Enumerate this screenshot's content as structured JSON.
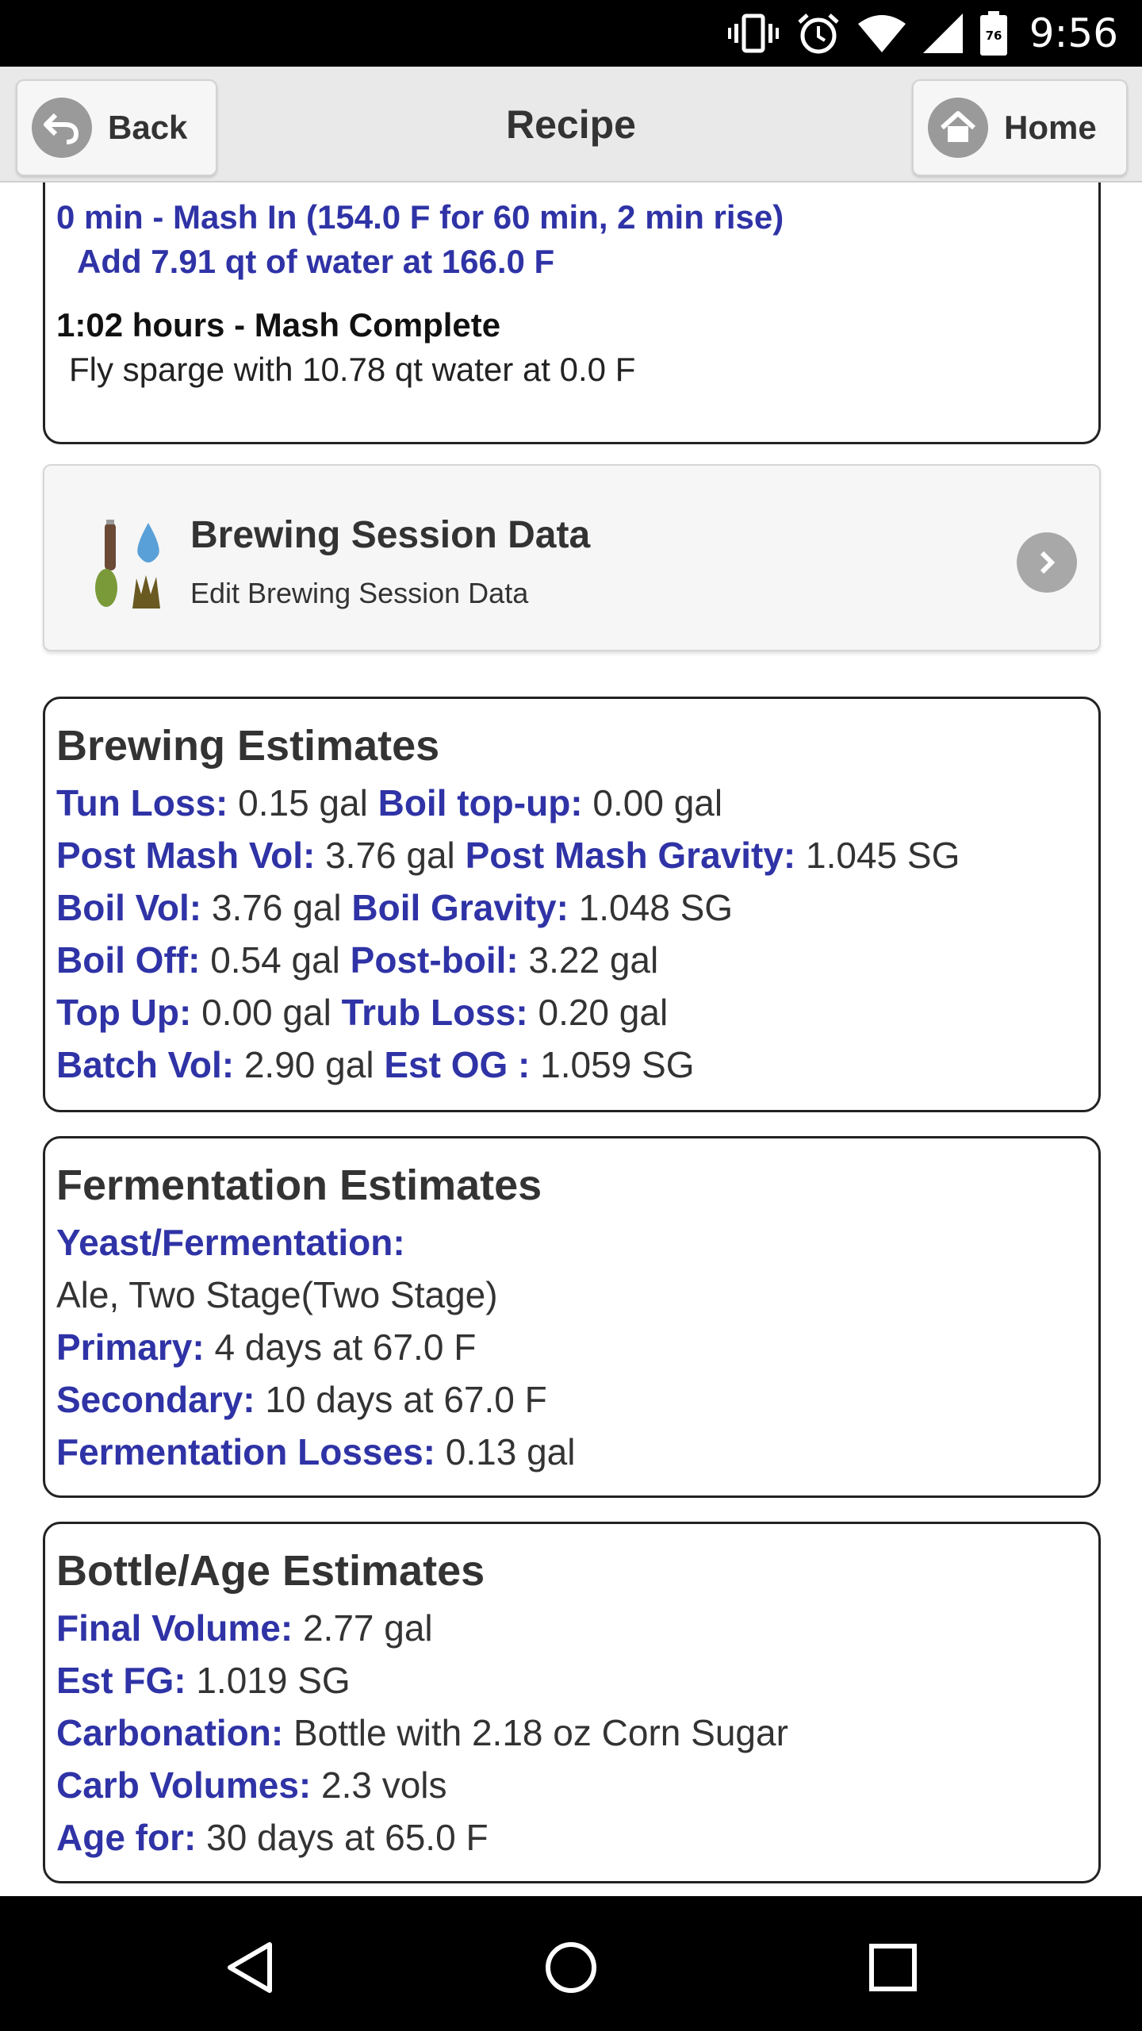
{
  "status": {
    "time": "9:56",
    "battery_level": "76"
  },
  "header": {
    "title": "Recipe",
    "back_label": "Back",
    "home_label": "Home"
  },
  "mash": {
    "step_line1": "0 min - Mash In (154.0 F for 60 min, 2 min rise)",
    "step_line2": "Add 7.91 qt of water at 166.0 F",
    "complete": "1:02 hours - Mash Complete",
    "sparge": "Fly sparge with 10.78 qt water at 0.0 F"
  },
  "session": {
    "title": "Brewing Session Data",
    "subtitle": "Edit Brewing Session Data"
  },
  "brewing": {
    "title": "Brewing Estimates",
    "rows": [
      [
        {
          "label": "Tun Loss:",
          "value": "0.15 gal"
        },
        {
          "label": "Boil top-up:",
          "value": "0.00 gal"
        }
      ],
      [
        {
          "label": "Post Mash Vol:",
          "value": "3.76 gal"
        },
        {
          "label": "Post Mash Gravity:",
          "value": "1.045 SG"
        }
      ],
      [
        {
          "label": "Boil Vol:",
          "value": "3.76 gal"
        },
        {
          "label": "Boil Gravity:",
          "value": "1.048 SG"
        }
      ],
      [
        {
          "label": "Boil Off:",
          "value": "0.54 gal"
        },
        {
          "label": "Post-boil:",
          "value": "3.22 gal"
        }
      ],
      [
        {
          "label": "Top Up:",
          "value": "0.00 gal"
        },
        {
          "label": "Trub Loss:",
          "value": "0.20 gal"
        }
      ],
      [
        {
          "label": "Batch Vol:",
          "value": "2.90 gal"
        },
        {
          "label": "Est OG :",
          "value": "1.059 SG"
        }
      ]
    ]
  },
  "fermentation": {
    "title": "Fermentation Estimates",
    "yeast_label": "Yeast/Fermentation:",
    "yeast_value": "Ale, Two Stage(Two Stage)",
    "rows": [
      {
        "label": "Primary:",
        "value": "4 days at 67.0 F"
      },
      {
        "label": "Secondary:",
        "value": "10 days at 67.0 F"
      },
      {
        "label": "Fermentation Losses:",
        "value": "0.13 gal"
      }
    ]
  },
  "bottle": {
    "title": "Bottle/Age Estimates",
    "rows": [
      {
        "label": "Final Volume:",
        "value": "2.77 gal"
      },
      {
        "label": "Est FG:",
        "value": "1.019 SG"
      },
      {
        "label": "Carbonation:",
        "value": "Bottle with 2.18 oz Corn Sugar"
      },
      {
        "label": "Carb Volumes:",
        "value": "2.3 vols"
      },
      {
        "label": "Age for:",
        "value": "30 days at 65.0 F"
      }
    ]
  },
  "icons": {
    "vibrate": "vibrate-icon",
    "alarm": "alarm-icon",
    "wifi": "wifi-icon",
    "signal": "signal-icon",
    "battery": "battery-icon",
    "back": "back-arrow-icon",
    "home": "home-icon",
    "session": "brewing-session-icon",
    "chevron": "chevron-right-icon",
    "nav_back": "nav-back-icon",
    "nav_home": "nav-home-icon",
    "nav_recent": "nav-recents-icon"
  },
  "colors": {
    "label_blue": "#2f33a6",
    "header_bg": "#e9e9e9",
    "text_dark": "#333333"
  }
}
